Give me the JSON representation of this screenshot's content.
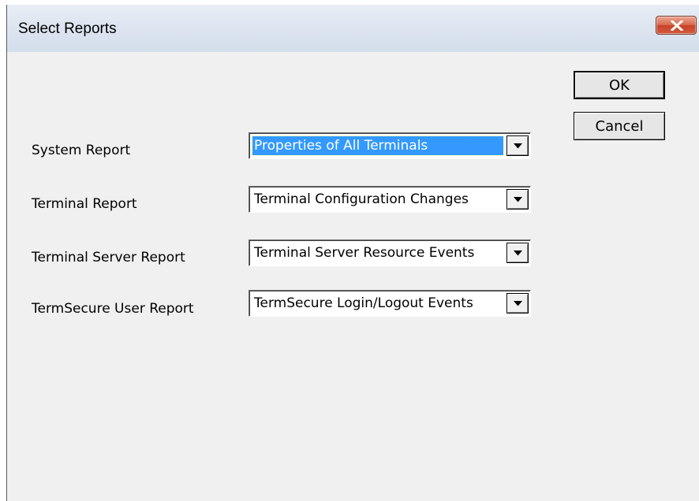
{
  "window": {
    "title": "Select Reports"
  },
  "buttons": {
    "ok_label": "OK",
    "cancel_label": "Cancel"
  },
  "reports": [
    {
      "label": "System Report",
      "value": "Properties of All Terminals",
      "selected": true
    },
    {
      "label": "Terminal Report",
      "value": "Terminal Configuration Changes",
      "selected": false
    },
    {
      "label": "Terminal Server Report",
      "value": "Terminal Server Resource Events",
      "selected": false
    },
    {
      "label": "TermSecure User Report",
      "value": "TermSecure Login/Logout Events",
      "selected": false
    }
  ],
  "icons": {
    "close": "close-icon",
    "dropdown": "chevron-down-icon"
  },
  "colors": {
    "selection": "#3399ff",
    "close_button": "#c8442a",
    "dialog_background": "#f0f0f0"
  }
}
